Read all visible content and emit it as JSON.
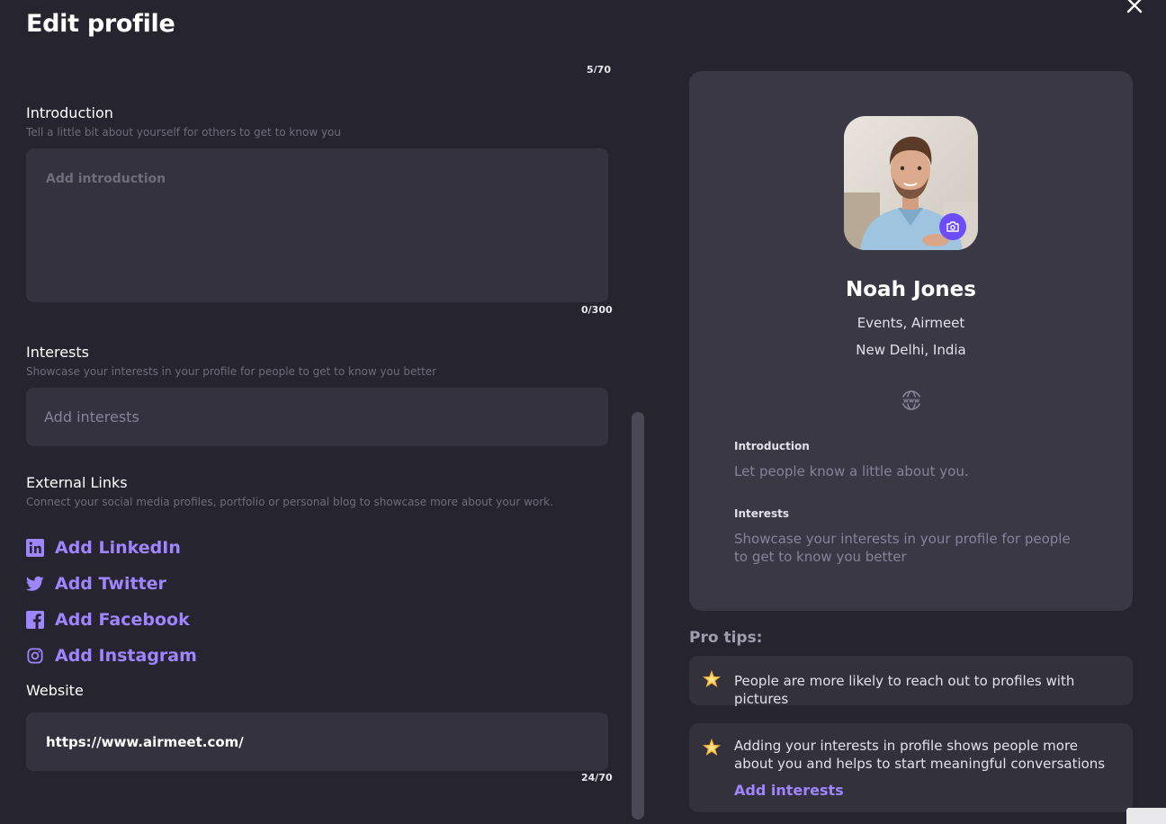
{
  "header": {
    "title": "Edit profile"
  },
  "top_count": "5/70",
  "introduction": {
    "label": "Introduction",
    "help": "Tell a little bit about yourself for others to get to know you",
    "placeholder": "Add introduction",
    "count": "0/300"
  },
  "interests": {
    "label": "Interests",
    "help": "Showcase your interests in your profile for people to get to know you better",
    "placeholder": "Add interests"
  },
  "external_links": {
    "label": "External Links",
    "help": "Connect your social media profiles, portfolio or personal blog to showcase more about your work.",
    "items": [
      {
        "label": "Add LinkedIn",
        "icon": "linkedin-icon"
      },
      {
        "label": "Add Twitter",
        "icon": "twitter-icon"
      },
      {
        "label": "Add Facebook",
        "icon": "facebook-icon"
      },
      {
        "label": "Add Instagram",
        "icon": "instagram-icon"
      }
    ]
  },
  "website": {
    "label": "Website",
    "value": "https://www.airmeet.com/",
    "count": "24/70"
  },
  "profile_card": {
    "name": "Noah Jones",
    "organization": "Events, Airmeet",
    "location": "New Delhi, India",
    "intro_title": "Introduction",
    "intro_text": "Let people know a little about you.",
    "interests_title": "Interests",
    "interests_text": "Showcase your interests in your profile for people to get to know you better"
  },
  "pro_tips": {
    "title": "Pro tips:",
    "tips": [
      {
        "text": "People are more likely to reach out to profiles with pictures"
      },
      {
        "text": "Adding your interests in profile shows people more about you and helps to start meaningful conversations",
        "link": "Add interests"
      }
    ]
  },
  "colors": {
    "background": "#26242f",
    "accent": "#9d86ff",
    "camera": "#6c4dfa",
    "card": "#3a3845",
    "input": "#34323e"
  }
}
